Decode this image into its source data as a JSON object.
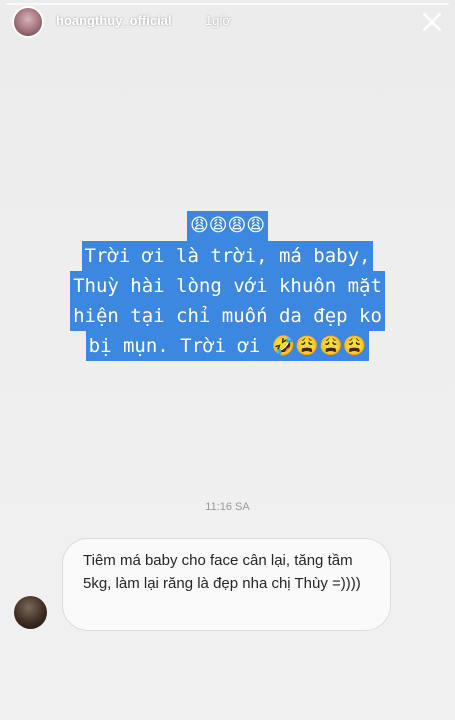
{
  "header": {
    "username": "hoangthuy_official",
    "time_ago": "1giờ",
    "close_icon": "close-icon"
  },
  "story": {
    "lines": [
      "😩😩😩😩",
      "Trời ơi là trời, má baby,",
      "Thuỳ hài lòng với khuôn mặt",
      "hiện tại chỉ muốn da đẹp ko",
      "bị mụn. Trời ơi 🤣😩😩😩"
    ],
    "highlight_color": "#3c87df"
  },
  "message": {
    "timestamp": "11:16 SA",
    "text": "Tiêm má baby cho face cân lại, tăng tầm 5kg, làm lại răng là đẹp nha chị Thùy =))))"
  }
}
